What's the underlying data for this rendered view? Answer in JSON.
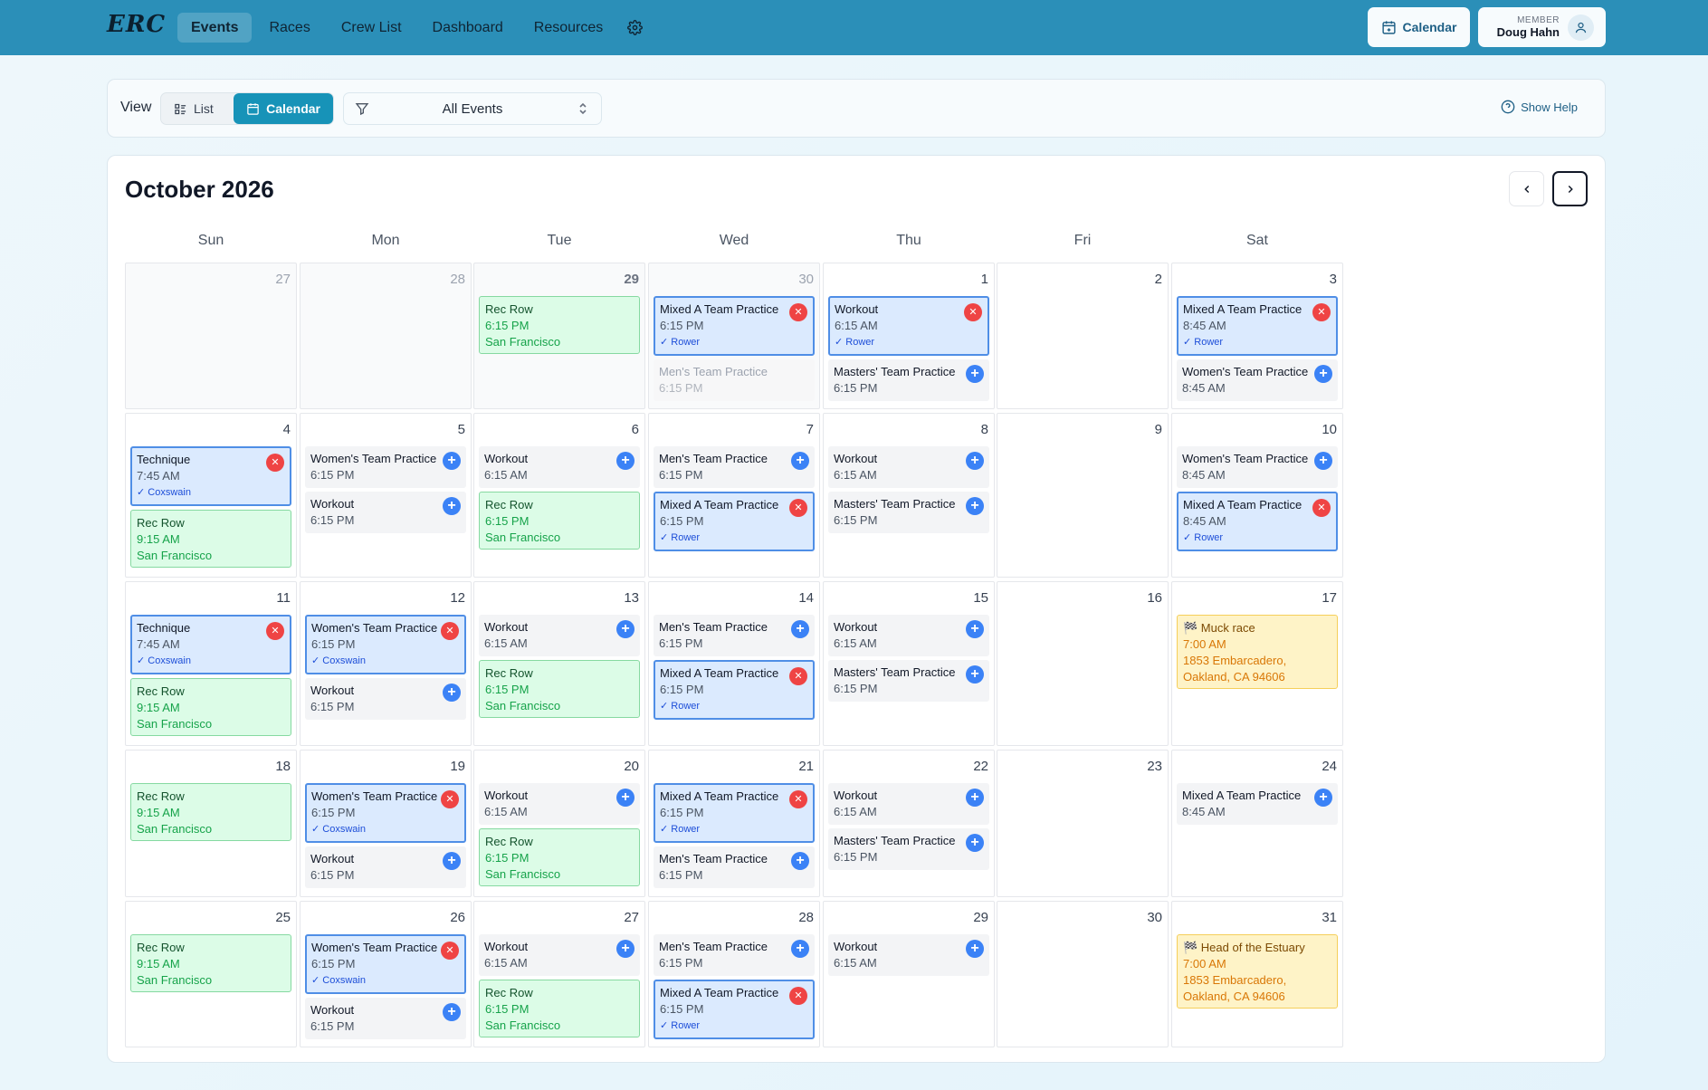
{
  "app": {
    "logo": "ERC",
    "nav": [
      {
        "label": "Events",
        "active": true
      },
      {
        "label": "Races",
        "active": false
      },
      {
        "label": "Crew List",
        "active": false
      },
      {
        "label": "Dashboard",
        "active": false
      },
      {
        "label": "Resources",
        "active": false
      }
    ],
    "calendar_button": "Calendar",
    "member_label": "MEMBER",
    "member_name": "Doug Hahn"
  },
  "toolbar": {
    "view_label": "View",
    "list_label": "List",
    "calendar_label": "Calendar",
    "filter_value": "All Events",
    "help_label": "Show Help"
  },
  "calendar": {
    "month_title": "October 2026",
    "weekdays": [
      "Sun",
      "Mon",
      "Tue",
      "Wed",
      "Thu",
      "Fri",
      "Sat"
    ],
    "colors": {
      "accent": "#1793b8",
      "nav": "#2b8fb8",
      "remove": "#ef4444",
      "add": "#3b82f6"
    },
    "weeks": [
      [
        {
          "day": "27",
          "outside": true,
          "events": []
        },
        {
          "day": "28",
          "outside": true,
          "events": []
        },
        {
          "day": "29",
          "outside": true,
          "strong": true,
          "events": [
            {
              "style": "green",
              "title": "Rec Row",
              "time": "6:15 PM",
              "location": "San Francisco"
            }
          ]
        },
        {
          "day": "30",
          "outside": true,
          "events": [
            {
              "style": "blue",
              "title": "Mixed A Team Practice",
              "time": "6:15 PM",
              "role": "✓ Rower",
              "action": "remove"
            },
            {
              "style": "muted",
              "title": "Men's Team Practice",
              "time": "6:15 PM"
            }
          ]
        },
        {
          "day": "1",
          "events": [
            {
              "style": "blue",
              "title": "Workout",
              "time": "6:15 AM",
              "role": "✓ Rower",
              "action": "remove"
            },
            {
              "style": "gray",
              "title": "Masters' Team Practice",
              "time": "6:15 PM",
              "action": "add"
            }
          ]
        },
        {
          "day": "2",
          "events": []
        },
        {
          "day": "3",
          "events": [
            {
              "style": "blue",
              "title": "Mixed A Team Practice",
              "time": "8:45 AM",
              "role": "✓ Rower",
              "action": "remove"
            },
            {
              "style": "gray",
              "title": "Women's Team Practice",
              "time": "8:45 AM",
              "action": "add"
            }
          ]
        }
      ],
      [
        {
          "day": "4",
          "events": [
            {
              "style": "blue",
              "title": "Technique",
              "time": "7:45 AM",
              "role": "✓ Coxswain",
              "action": "remove"
            },
            {
              "style": "green",
              "title": "Rec Row",
              "time": "9:15 AM",
              "location": "San Francisco"
            }
          ]
        },
        {
          "day": "5",
          "events": [
            {
              "style": "gray",
              "title": "Women's Team Practice",
              "time": "6:15 PM",
              "action": "add"
            },
            {
              "style": "gray",
              "title": "Workout",
              "time": "6:15 PM",
              "action": "add"
            }
          ]
        },
        {
          "day": "6",
          "events": [
            {
              "style": "gray",
              "title": "Workout",
              "time": "6:15 AM",
              "action": "add"
            },
            {
              "style": "green",
              "title": "Rec Row",
              "time": "6:15 PM",
              "location": "San Francisco"
            }
          ]
        },
        {
          "day": "7",
          "events": [
            {
              "style": "gray",
              "title": "Men's Team Practice",
              "time": "6:15 PM",
              "action": "add"
            },
            {
              "style": "blue",
              "title": "Mixed A Team Practice",
              "time": "6:15 PM",
              "role": "✓ Rower",
              "action": "remove"
            }
          ]
        },
        {
          "day": "8",
          "events": [
            {
              "style": "gray",
              "title": "Workout",
              "time": "6:15 AM",
              "action": "add"
            },
            {
              "style": "gray",
              "title": "Masters' Team Practice",
              "time": "6:15 PM",
              "action": "add"
            }
          ]
        },
        {
          "day": "9",
          "events": []
        },
        {
          "day": "10",
          "events": [
            {
              "style": "gray",
              "title": "Women's Team Practice",
              "time": "8:45 AM",
              "action": "add"
            },
            {
              "style": "blue",
              "title": "Mixed A Team Practice",
              "time": "8:45 AM",
              "role": "✓ Rower",
              "action": "remove"
            }
          ]
        }
      ],
      [
        {
          "day": "11",
          "events": [
            {
              "style": "blue",
              "title": "Technique",
              "time": "7:45 AM",
              "role": "✓ Coxswain",
              "action": "remove"
            },
            {
              "style": "green",
              "title": "Rec Row",
              "time": "9:15 AM",
              "location": "San Francisco"
            }
          ]
        },
        {
          "day": "12",
          "events": [
            {
              "style": "blue",
              "title": "Women's Team Practice",
              "time": "6:15 PM",
              "role": "✓ Coxswain",
              "action": "remove"
            },
            {
              "style": "gray",
              "title": "Workout",
              "time": "6:15 PM",
              "action": "add"
            }
          ]
        },
        {
          "day": "13",
          "events": [
            {
              "style": "gray",
              "title": "Workout",
              "time": "6:15 AM",
              "action": "add"
            },
            {
              "style": "green",
              "title": "Rec Row",
              "time": "6:15 PM",
              "location": "San Francisco"
            }
          ]
        },
        {
          "day": "14",
          "events": [
            {
              "style": "gray",
              "title": "Men's Team Practice",
              "time": "6:15 PM",
              "action": "add"
            },
            {
              "style": "blue",
              "title": "Mixed A Team Practice",
              "time": "6:15 PM",
              "role": "✓ Rower",
              "action": "remove"
            }
          ]
        },
        {
          "day": "15",
          "events": [
            {
              "style": "gray",
              "title": "Workout",
              "time": "6:15 AM",
              "action": "add"
            },
            {
              "style": "gray",
              "title": "Masters' Team Practice",
              "time": "6:15 PM",
              "action": "add"
            }
          ]
        },
        {
          "day": "16",
          "events": []
        },
        {
          "day": "17",
          "events": [
            {
              "style": "yellow",
              "title": "🏁 Muck race",
              "time": "7:00 AM",
              "location": "1853 Embarcadero, Oakland, CA 94606"
            }
          ]
        }
      ],
      [
        {
          "day": "18",
          "events": [
            {
              "style": "green",
              "title": "Rec Row",
              "time": "9:15 AM",
              "location": "San Francisco"
            }
          ]
        },
        {
          "day": "19",
          "events": [
            {
              "style": "blue",
              "title": "Women's Team Practice",
              "time": "6:15 PM",
              "role": "✓ Coxswain",
              "action": "remove"
            },
            {
              "style": "gray",
              "title": "Workout",
              "time": "6:15 PM",
              "action": "add"
            }
          ]
        },
        {
          "day": "20",
          "events": [
            {
              "style": "gray",
              "title": "Workout",
              "time": "6:15 AM",
              "action": "add"
            },
            {
              "style": "green",
              "title": "Rec Row",
              "time": "6:15 PM",
              "location": "San Francisco"
            }
          ]
        },
        {
          "day": "21",
          "events": [
            {
              "style": "blue",
              "title": "Mixed A Team Practice",
              "time": "6:15 PM",
              "role": "✓ Rower",
              "action": "remove"
            },
            {
              "style": "gray",
              "title": "Men's Team Practice",
              "time": "6:15 PM",
              "action": "add"
            }
          ]
        },
        {
          "day": "22",
          "events": [
            {
              "style": "gray",
              "title": "Workout",
              "time": "6:15 AM",
              "action": "add"
            },
            {
              "style": "gray",
              "title": "Masters' Team Practice",
              "time": "6:15 PM",
              "action": "add"
            }
          ]
        },
        {
          "day": "23",
          "events": []
        },
        {
          "day": "24",
          "events": [
            {
              "style": "gray",
              "title": "Mixed A Team Practice",
              "time": "8:45 AM",
              "action": "add"
            }
          ]
        }
      ],
      [
        {
          "day": "25",
          "events": [
            {
              "style": "green",
              "title": "Rec Row",
              "time": "9:15 AM",
              "location": "San Francisco"
            }
          ]
        },
        {
          "day": "26",
          "events": [
            {
              "style": "blue",
              "title": "Women's Team Practice",
              "time": "6:15 PM",
              "role": "✓ Coxswain",
              "action": "remove"
            },
            {
              "style": "gray",
              "title": "Workout",
              "time": "6:15 PM",
              "action": "add"
            }
          ]
        },
        {
          "day": "27",
          "events": [
            {
              "style": "gray",
              "title": "Workout",
              "time": "6:15 AM",
              "action": "add"
            },
            {
              "style": "green",
              "title": "Rec Row",
              "time": "6:15 PM",
              "location": "San Francisco"
            }
          ]
        },
        {
          "day": "28",
          "events": [
            {
              "style": "gray",
              "title": "Men's Team Practice",
              "time": "6:15 PM",
              "action": "add"
            },
            {
              "style": "blue",
              "title": "Mixed A Team Practice",
              "time": "6:15 PM",
              "role": "✓ Rower",
              "action": "remove"
            }
          ]
        },
        {
          "day": "29",
          "events": [
            {
              "style": "gray",
              "title": "Workout",
              "time": "6:15 AM",
              "action": "add"
            }
          ]
        },
        {
          "day": "30",
          "events": []
        },
        {
          "day": "31",
          "events": [
            {
              "style": "yellow",
              "title": "🏁 Head of the Estuary",
              "time": "7:00 AM",
              "location": "1853 Embarcadero, Oakland, CA 94606"
            }
          ]
        }
      ]
    ]
  }
}
